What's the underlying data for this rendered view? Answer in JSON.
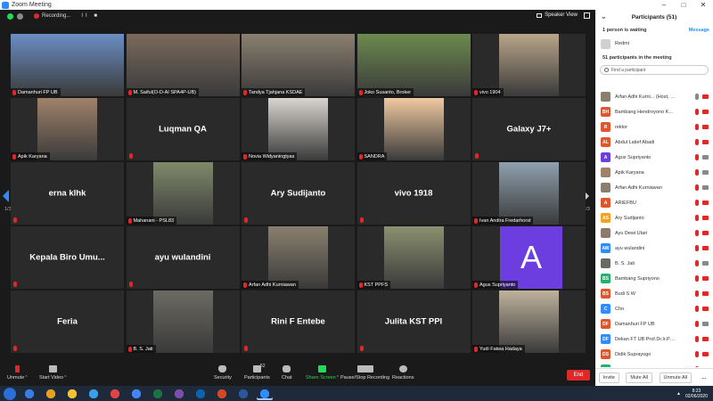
{
  "window": {
    "title": "Zoom Meeting",
    "controls": [
      "–",
      "□",
      "✕"
    ]
  },
  "topbar": {
    "recording_label": "Recording...",
    "recording_controls": "II ■",
    "view_label": "Speaker View"
  },
  "grid": {
    "page_left": "1/3",
    "page_right": "1/3",
    "tiles": [
      {
        "label": "Damanhuri FP UB",
        "mic": true,
        "photo": "#6b8ec4"
      },
      {
        "label": "M. Saiful(O-D-AI SPA4P-UB)",
        "mic": true,
        "photo": "#7a6a5c"
      },
      {
        "label": "Tandya Tjahjana KSDAE",
        "mic": true,
        "photo": "#8b8070"
      },
      {
        "label": "Joko Susanto, Broker",
        "mic": true,
        "photo": "#6c8a4e"
      },
      {
        "label": "vivo 1904",
        "mic": true,
        "photo": "#b9a58a"
      },
      {
        "label": "Apik Karyana",
        "mic": true,
        "photo": "#a0826b"
      },
      {
        "center": "Luqman QA",
        "mic": true
      },
      {
        "label": "Novia Widyaningtyas",
        "mic": true,
        "photo": "#d9d4cf"
      },
      {
        "label": "SANDRA",
        "mic": true,
        "photo": "#f0c9a0"
      },
      {
        "center": "Galaxy J7+",
        "mic": true
      },
      {
        "center": "erna klhk",
        "mic": true
      },
      {
        "label": "Mahanani - PSL83",
        "mic": true,
        "photo": "#7f8a6a"
      },
      {
        "center": "Ary Sudijanto",
        "mic": true
      },
      {
        "center": "vivo 1918",
        "mic": true
      },
      {
        "label": "Ivan Andira Fredarhorst",
        "mic": true,
        "photo": "#8fa0ae"
      },
      {
        "center": "Kepala Biro Umu...",
        "mic": true
      },
      {
        "center": "ayu wulandini",
        "mic": true
      },
      {
        "label": "Arfan Adhi Kurniawan",
        "mic": true,
        "photo": "#8a7f6e"
      },
      {
        "label": "KST PPFS",
        "mic": true,
        "photo": "#8a9070"
      },
      {
        "label": "Agus Supriyanto",
        "mic": true,
        "avatar": "A"
      },
      {
        "center": "Feria",
        "mic": true
      },
      {
        "label": "B. S. Jati",
        "mic": true,
        "photo": "#6b6a62"
      },
      {
        "center": "Rini F Entebe",
        "mic": true
      },
      {
        "center": "Julita KST PPI",
        "mic": true
      },
      {
        "label": "Yudi Fatwa Hadaya",
        "mic": true,
        "photo": "#bfb29c"
      }
    ]
  },
  "toolbar": {
    "unmute": "Unmute",
    "start_video": "Start Video",
    "security": "Security",
    "participants": "Participants",
    "participants_count": "52",
    "chat": "Chat",
    "share_screen": "Share Screen",
    "pause_recording": "Pause/Stop Recording",
    "reactions": "Reactions",
    "end": "End"
  },
  "panel": {
    "title": "Participants (51)",
    "waiting": "1 person is waiting",
    "message": "Message",
    "waiting_person": "Redmi",
    "in_meeting": "51 participants in the meeting",
    "search_placeholder": "Find a participant",
    "participants": [
      {
        "name": "Arfan Adhi Kurni... (Host, me)",
        "initials": "",
        "color": "#8a7f6e",
        "mic": "on",
        "cam": "off"
      },
      {
        "name": "Bambang Hendroyono KLHK",
        "initials": "BH",
        "color": "#e0552b",
        "mic": "off",
        "cam": "off"
      },
      {
        "name": "rektor",
        "initials": "R",
        "color": "#e0552b",
        "mic": "off",
        "cam": "off"
      },
      {
        "name": "Abdul Latief Abadi",
        "initials": "AL",
        "color": "#e0552b",
        "mic": "off",
        "cam": "off"
      },
      {
        "name": "Agus Supriyanto",
        "initials": "A",
        "color": "#6c3ee0",
        "mic": "off",
        "cam": "on"
      },
      {
        "name": "Apik Karyana",
        "initials": "",
        "color": "#a0826b",
        "mic": "off",
        "cam": "on"
      },
      {
        "name": "Arfan Adhi Kurniawan",
        "initials": "",
        "color": "#8a7f6e",
        "mic": "off",
        "cam": "on"
      },
      {
        "name": "ARIEFBU",
        "initials": "A",
        "color": "#e0552b",
        "mic": "off",
        "cam": "off"
      },
      {
        "name": "Ary Sudijanto",
        "initials": "AS",
        "color": "#f4a11d",
        "mic": "off",
        "cam": "off"
      },
      {
        "name": "Ayu Dewi Utari",
        "initials": "",
        "color": "#8b7b6b",
        "mic": "off",
        "cam": "off"
      },
      {
        "name": "ayu wulandini",
        "initials": "AW",
        "color": "#2d8cff",
        "mic": "off",
        "cam": "off"
      },
      {
        "name": "B. S. Jati",
        "initials": "",
        "color": "#6b6a62",
        "mic": "off",
        "cam": "on"
      },
      {
        "name": "Bambang Supriyono",
        "initials": "BS",
        "color": "#23b26d",
        "mic": "off",
        "cam": "off"
      },
      {
        "name": "Budi S W",
        "initials": "BS",
        "color": "#e0552b",
        "mic": "off",
        "cam": "off"
      },
      {
        "name": "Cho",
        "initials": "C",
        "color": "#2d8cff",
        "mic": "off",
        "cam": "off"
      },
      {
        "name": "Damanhuri FP UB",
        "initials": "DF",
        "color": "#e0552b",
        "mic": "off",
        "cam": "on"
      },
      {
        "name": "Dekan FT UB Prof.Dr.Ir.Pitojo TJ",
        "initials": "DF",
        "color": "#2d8cff",
        "mic": "off",
        "cam": "off"
      },
      {
        "name": "Didik Suprayogo",
        "initials": "DS",
        "color": "#e0552b",
        "mic": "off",
        "cam": "off"
      },
      {
        "name": "Erik Sahdian PSKL",
        "initials": "ES",
        "color": "#23b26d",
        "mic": "off",
        "cam": "off"
      }
    ],
    "footer": {
      "invite": "Invite",
      "mute_all": "Mute All",
      "unmute_all": "Unmute All",
      "more": "..."
    }
  },
  "taskbar": {
    "apps": [
      "#3c7be0",
      "#e8a020",
      "#f1c232",
      "#3a9ee8",
      "#e04444",
      "#4285f4",
      "#1e7145",
      "#7b4ea8",
      "#0a64ad",
      "#d24726",
      "#2b579a",
      "#2d8cff"
    ],
    "active_app": 11,
    "time": "8:23",
    "date": "02/06/2020"
  },
  "colors": {
    "accent": "#2d8cff",
    "muted": "#e02828",
    "share": "#23d959",
    "end": "#e02828"
  }
}
